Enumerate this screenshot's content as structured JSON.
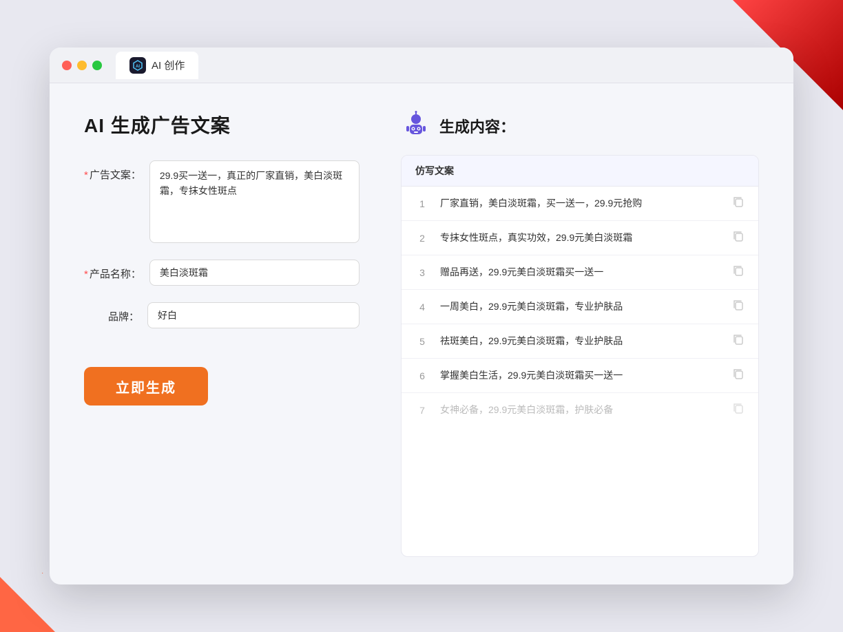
{
  "window": {
    "tab_label": "AI 创作",
    "ai_icon_text": "AI"
  },
  "left": {
    "page_title": "AI 生成广告文案",
    "fields": [
      {
        "id": "ad_copy",
        "label": "广告文案：",
        "required": true,
        "value": "29.9买一送一，真正的厂家直销，美白淡斑霜，专抹女性斑点",
        "multiline": true
      },
      {
        "id": "product_name",
        "label": "产品名称：",
        "required": true,
        "value": "美白淡斑霜",
        "multiline": false
      },
      {
        "id": "brand",
        "label": "品牌：",
        "required": false,
        "value": "好白",
        "multiline": false
      }
    ],
    "generate_button": "立即生成"
  },
  "right": {
    "header_title": "生成内容：",
    "table_header": "仿写文案",
    "rows": [
      {
        "num": "1",
        "text": "厂家直销，美白淡斑霜，买一送一，29.9元抢购",
        "dimmed": false
      },
      {
        "num": "2",
        "text": "专抹女性斑点，真实功效，29.9元美白淡斑霜",
        "dimmed": false
      },
      {
        "num": "3",
        "text": "赠品再送，29.9元美白淡斑霜买一送一",
        "dimmed": false
      },
      {
        "num": "4",
        "text": "一周美白，29.9元美白淡斑霜，专业护肤品",
        "dimmed": false
      },
      {
        "num": "5",
        "text": "祛斑美白，29.9元美白淡斑霜，专业护肤品",
        "dimmed": false
      },
      {
        "num": "6",
        "text": "掌握美白生活，29.9元美白淡斑霜买一送一",
        "dimmed": false
      },
      {
        "num": "7",
        "text": "女神必备，29.9元美白淡斑霜，护肤必备",
        "dimmed": true
      }
    ]
  }
}
